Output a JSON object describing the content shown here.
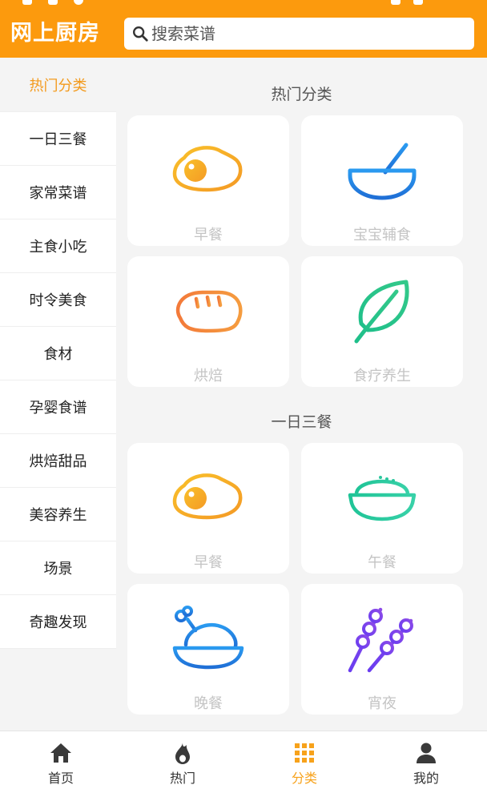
{
  "header": {
    "title": "网上厨房",
    "search_placeholder": "搜索菜谱",
    "brand_color": "#fc9a0d"
  },
  "sidebar": {
    "items": [
      {
        "label": "热门分类",
        "active": true
      },
      {
        "label": "一日三餐"
      },
      {
        "label": "家常菜谱"
      },
      {
        "label": "主食小吃"
      },
      {
        "label": "时令美食"
      },
      {
        "label": "食材"
      },
      {
        "label": "孕婴食谱"
      },
      {
        "label": "烘焙甜品"
      },
      {
        "label": "美容养生"
      },
      {
        "label": "场景"
      },
      {
        "label": "奇趣发现"
      }
    ]
  },
  "sections": [
    {
      "title": "热门分类",
      "cards": [
        {
          "label": "早餐",
          "icon": "fried-egg-icon"
        },
        {
          "label": "宝宝辅食",
          "icon": "bowl-spoon-icon"
        },
        {
          "label": "烘焙",
          "icon": "bread-icon"
        },
        {
          "label": "食疗养生",
          "icon": "leaf-icon"
        }
      ]
    },
    {
      "title": "一日三餐",
      "cards": [
        {
          "label": "早餐",
          "icon": "fried-egg-icon"
        },
        {
          "label": "午餐",
          "icon": "rice-bowl-icon"
        },
        {
          "label": "晚餐",
          "icon": "roast-chicken-icon"
        },
        {
          "label": "宵夜",
          "icon": "skewers-icon"
        }
      ]
    }
  ],
  "bottom_nav": {
    "items": [
      {
        "label": "首页",
        "icon": "home-icon"
      },
      {
        "label": "热门",
        "icon": "flame-icon"
      },
      {
        "label": "分类",
        "icon": "grid-icon",
        "active": true
      },
      {
        "label": "我的",
        "icon": "user-icon"
      }
    ],
    "active_color": "#f7a21b"
  }
}
